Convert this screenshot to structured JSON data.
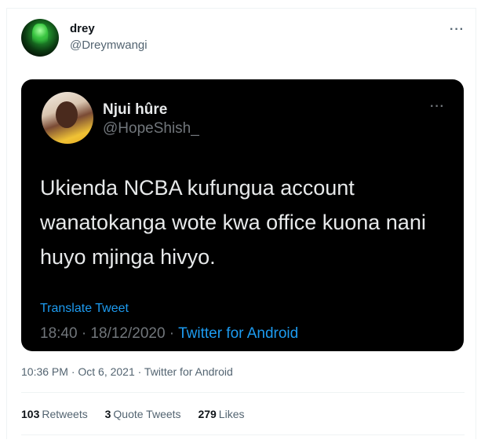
{
  "tweet": {
    "author_name": "drey",
    "author_handle": "@Dreymwangi",
    "more_label": "···",
    "timestamp": "10:36 PM · Oct 6, 2021 · Twitter for Android",
    "stats": {
      "retweets_count": "103",
      "retweets_label": "Retweets",
      "quote_count": "3",
      "quote_label": "Quote Tweets",
      "likes_count": "279",
      "likes_label": "Likes"
    }
  },
  "embedded": {
    "name": "Njui hûre",
    "handle": "@HopeShish_",
    "more_label": "···",
    "text": "Ukienda NCBA kufungua account wanatokanga wote kwa office kuona nani huyo mjinga hivyo.",
    "translate_label": "Translate Tweet",
    "time_date": "18:40 · 18/12/2020 · ",
    "app": "Twitter for Android"
  }
}
